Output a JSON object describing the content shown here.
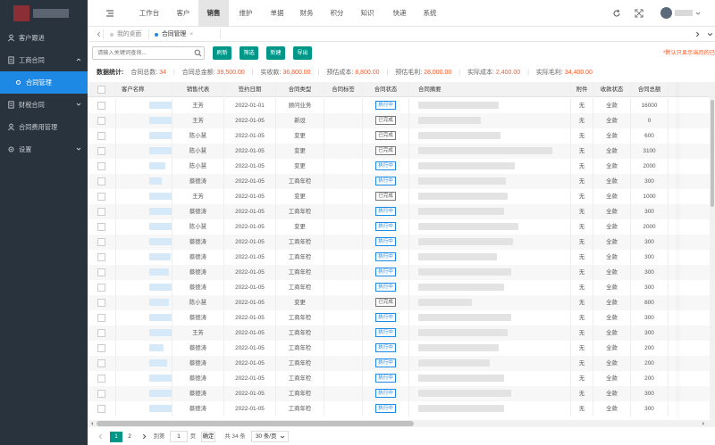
{
  "sidebar": {
    "items": [
      {
        "label": "客户跟进",
        "icon": "user-icon"
      },
      {
        "label": "工商合同",
        "icon": "document-icon"
      },
      {
        "label": "财税合同",
        "icon": "document-icon"
      },
      {
        "label": "合同费用管理",
        "icon": "user-icon"
      },
      {
        "label": "设置",
        "icon": "gear-icon"
      }
    ],
    "active_sub": "合同管理"
  },
  "nav": {
    "items": [
      "工作台",
      "客户",
      "销售",
      "维护",
      "单据",
      "财务",
      "积分",
      "知识",
      "快递",
      "系统"
    ],
    "active": "销售"
  },
  "tabs": [
    {
      "label": "我的桌面",
      "active": false
    },
    {
      "label": "合同管理",
      "active": true,
      "close": "×"
    }
  ],
  "toolbar": {
    "search_placeholder": "请输入关键词查询...",
    "buttons": [
      "刷新",
      "筛选",
      "新建",
      "导出"
    ],
    "hint": "*默认只显示当月的已"
  },
  "stats": {
    "label": "数据统计:",
    "items": [
      {
        "label": "合同总数:",
        "value": "34"
      },
      {
        "label": "合同总金额:",
        "value": "39,500.00"
      },
      {
        "label": "实收款:",
        "value": "36,800.00"
      },
      {
        "label": "预估成本:",
        "value": "8,800.00"
      },
      {
        "label": "预估毛利:",
        "value": "28,000.00"
      },
      {
        "label": "实际成本:",
        "value": "2,400.00"
      },
      {
        "label": "实际毛利:",
        "value": "34,400.00"
      }
    ]
  },
  "table": {
    "headers": [
      "客户名称",
      "销售代表",
      "签约日期",
      "合同类型",
      "合同标签",
      "合同状态",
      "合同摘要",
      "附件",
      "收款状态",
      "合同总额"
    ],
    "rows": [
      {
        "rep": "王芳",
        "date": "2022-01-01",
        "type": "顾问业务",
        "status": "执行中",
        "attach": "无",
        "pay": "全款",
        "total": "16000"
      },
      {
        "rep": "王芳",
        "date": "2022-01-05",
        "type": "新设",
        "status": "已完成",
        "attach": "无",
        "pay": "全款",
        "total": "0"
      },
      {
        "rep": "陈小慧",
        "date": "2022-01-05",
        "type": "变更",
        "status": "已完成",
        "attach": "无",
        "pay": "全款",
        "total": "600"
      },
      {
        "rep": "陈小慧",
        "date": "2022-01-05",
        "type": "变更",
        "status": "已完成",
        "attach": "无",
        "pay": "全款",
        "total": "3100"
      },
      {
        "rep": "陈小慧",
        "date": "2022-01-05",
        "type": "变更",
        "status": "执行中",
        "attach": "无",
        "pay": "全款",
        "total": "2000"
      },
      {
        "rep": "蔡德涛",
        "date": "2022-01-05",
        "type": "工商年检",
        "status": "执行中",
        "attach": "无",
        "pay": "全款",
        "total": "300"
      },
      {
        "rep": "王芳",
        "date": "2022-01-05",
        "type": "变更",
        "status": "已完成",
        "attach": "无",
        "pay": "全款",
        "total": "1000"
      },
      {
        "rep": "蔡德涛",
        "date": "2022-01-05",
        "type": "工商年检",
        "status": "执行中",
        "attach": "无",
        "pay": "全款",
        "total": "300"
      },
      {
        "rep": "陈小慧",
        "date": "2022-01-05",
        "type": "变更",
        "status": "执行中",
        "attach": "无",
        "pay": "全款",
        "total": "2000"
      },
      {
        "rep": "蔡德涛",
        "date": "2022-01-05",
        "type": "工商年检",
        "status": "执行中",
        "attach": "无",
        "pay": "全款",
        "total": "300"
      },
      {
        "rep": "蔡德涛",
        "date": "2022-01-05",
        "type": "工商年检",
        "status": "执行中",
        "attach": "无",
        "pay": "全款",
        "total": "300"
      },
      {
        "rep": "蔡德涛",
        "date": "2022-01-05",
        "type": "工商年检",
        "status": "执行中",
        "attach": "无",
        "pay": "全款",
        "total": "300"
      },
      {
        "rep": "蔡德涛",
        "date": "2022-01-05",
        "type": "工商年检",
        "status": "执行中",
        "attach": "无",
        "pay": "全款",
        "total": "300"
      },
      {
        "rep": "陈小慧",
        "date": "2022-01-05",
        "type": "变更",
        "status": "已完成",
        "attach": "无",
        "pay": "全款",
        "total": "800"
      },
      {
        "rep": "蔡德涛",
        "date": "2022-01-05",
        "type": "工商年检",
        "status": "执行中",
        "attach": "无",
        "pay": "全款",
        "total": "300"
      },
      {
        "rep": "王芳",
        "date": "2022-01-05",
        "type": "工商年检",
        "status": "执行中",
        "attach": "无",
        "pay": "全款",
        "total": "300"
      },
      {
        "rep": "蔡德涛",
        "date": "2022-01-05",
        "type": "工商年检",
        "status": "执行中",
        "attach": "无",
        "pay": "全款",
        "total": "200"
      },
      {
        "rep": "蔡德涛",
        "date": "2022-01-05",
        "type": "工商年检",
        "status": "执行中",
        "attach": "无",
        "pay": "全款",
        "total": "200"
      },
      {
        "rep": "蔡德涛",
        "date": "2022-01-05",
        "type": "工商年检",
        "status": "执行中",
        "attach": "无",
        "pay": "全款",
        "total": "200"
      },
      {
        "rep": "蔡德涛",
        "date": "2022-01-05",
        "type": "工商年检",
        "status": "执行中",
        "attach": "无",
        "pay": "全款",
        "total": "300"
      },
      {
        "rep": "蔡德涛",
        "date": "2022-01-05",
        "type": "工商年检",
        "status": "执行中",
        "attach": "无",
        "pay": "全款",
        "total": "300"
      }
    ]
  },
  "pager": {
    "pages": [
      "1",
      "2"
    ],
    "current": "1",
    "goto_label": "到第",
    "goto_value": "1",
    "page_unit": "页",
    "confirm": "确定",
    "total": "共 34 条",
    "page_size": "30 条/页"
  },
  "colors": {
    "sidebar_bg": "#28333e",
    "accent_blue": "#1e88e5",
    "primary_green": "#009688",
    "highlight_orange": "#ff5722"
  }
}
